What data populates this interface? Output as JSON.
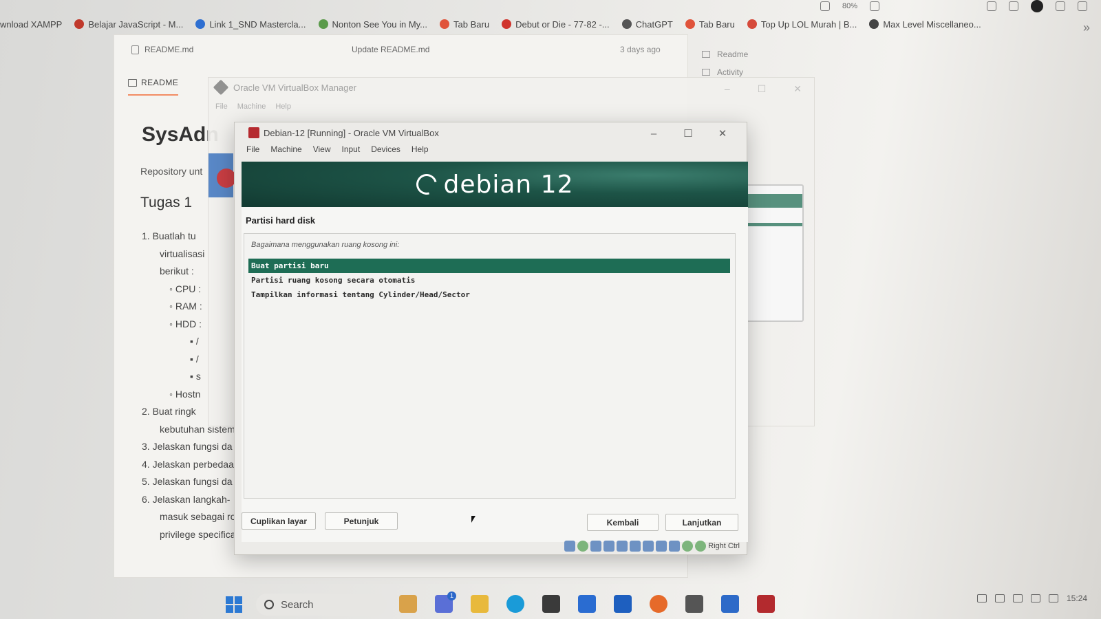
{
  "browser": {
    "zoom": "80%",
    "bookmarks": [
      {
        "label": "wnload XAMPP",
        "color": ""
      },
      {
        "label": "Belajar JavaScript - M...",
        "color": "#c0392b"
      },
      {
        "label": "Link 1_SND Mastercla...",
        "color": "#2e6fd1"
      },
      {
        "label": "Nonton See You in My...",
        "color": "#5a9a4a"
      },
      {
        "label": "Tab Baru",
        "color": "#e0533a"
      },
      {
        "label": "Debut or Die - 77-82 -...",
        "color": "#d0342c"
      },
      {
        "label": "ChatGPT",
        "color": "#555555"
      },
      {
        "label": "Tab Baru",
        "color": "#e0533a"
      },
      {
        "label": "Top Up LOL Murah | B...",
        "color": "#d64a3a"
      },
      {
        "label": "Max Level Miscellaneo...",
        "color": "#444444"
      }
    ]
  },
  "github": {
    "file_name": "README.md",
    "commit_message": "Update README.md",
    "commit_time": "3 days ago",
    "readme_tab": "README",
    "title": "SysAdn",
    "description": "Repository unt",
    "section": "Tugas 1",
    "list": [
      {
        "text": "1. Buatlah tu",
        "level": 1
      },
      {
        "text": "virtualisasi",
        "level": 2
      },
      {
        "text": "berikut :",
        "level": 2
      },
      {
        "text": "◦ CPU :",
        "level": 3
      },
      {
        "text": "◦ RAM :",
        "level": 3
      },
      {
        "text": "◦ HDD :",
        "level": 3
      },
      {
        "text": "▪ /",
        "level": 4
      },
      {
        "text": "▪ /",
        "level": 4
      },
      {
        "text": "▪ s",
        "level": 4
      },
      {
        "text": "◦ Hostn",
        "level": 3
      },
      {
        "text": "2. Buat ringk",
        "level": 1
      },
      {
        "text": "kebutuhan sistem",
        "level": 2
      },
      {
        "text": "3. Jelaskan fungsi da",
        "level": 1
      },
      {
        "text": "4. Jelaskan perbedaa",
        "level": 1
      },
      {
        "text": "5. Jelaskan fungsi da",
        "level": 1
      },
      {
        "text": "6. Jelaskan langkah-",
        "level": 1
      },
      {
        "text": "masuk sebagai ro",
        "level": 2
      },
      {
        "text": "privilege specifica",
        "level": 2
      }
    ],
    "side_readme": "Readme",
    "side_activity": "Activity"
  },
  "vbox_manager": {
    "title": "Oracle VM VirtualBox Manager",
    "menu": [
      "File",
      "Machine",
      "Help"
    ]
  },
  "vm": {
    "title": "Debian-12 [Running] - Oracle VM VirtualBox",
    "menu": [
      "File",
      "Machine",
      "View",
      "Input",
      "Devices",
      "Help"
    ],
    "banner": "debian 12",
    "step_title": "Partisi hard disk",
    "question": "Bagaimana menggunakan ruang kosong ini:",
    "options": [
      {
        "label": "Buat partisi baru",
        "selected": true
      },
      {
        "label": "Partisi ruang kosong secara otomatis",
        "selected": false
      },
      {
        "label": "Tampilkan informasi tentang Cylinder/Head/Sector",
        "selected": false
      }
    ],
    "buttons": {
      "screenshot": "Cuplikan layar",
      "help": "Petunjuk",
      "back": "Kembali",
      "continue": "Lanjutkan"
    },
    "host_key": "Right Ctrl"
  },
  "taskbar": {
    "search_placeholder": "Search",
    "time": "15:24",
    "badge": "1"
  }
}
